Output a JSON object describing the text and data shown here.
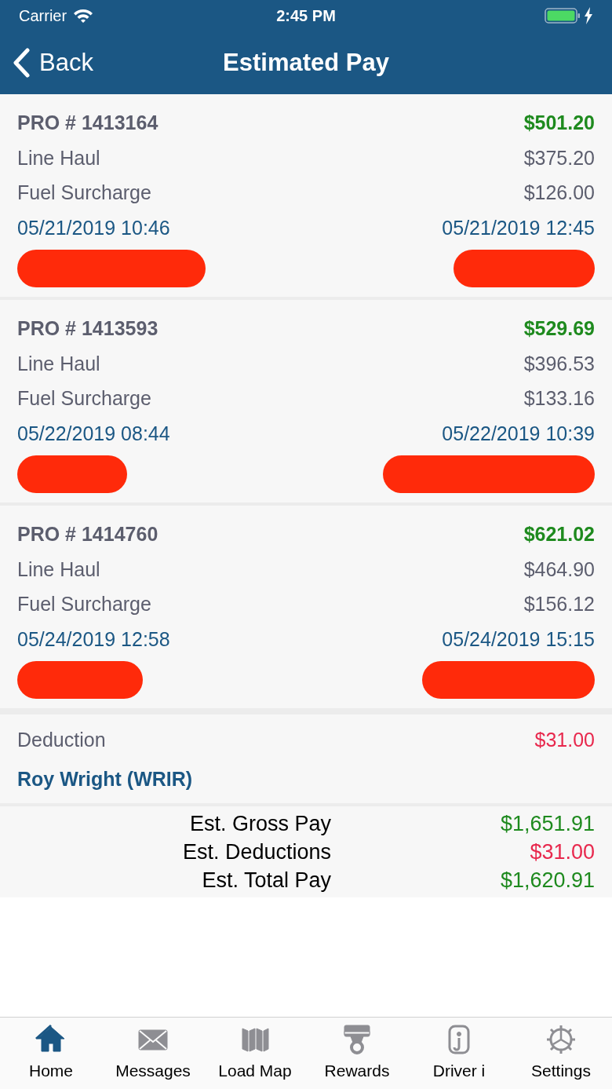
{
  "status_bar": {
    "carrier": "Carrier",
    "time": "2:45 PM",
    "charging": true
  },
  "nav": {
    "back": "Back",
    "title": "Estimated Pay"
  },
  "loads": [
    {
      "pro": "PRO # 1413164",
      "total": "$501.20",
      "lines": [
        {
          "label": "Line Haul",
          "amount": "$375.20"
        },
        {
          "label": "Fuel Surcharge",
          "amount": "$126.00"
        }
      ],
      "start": "05/21/2019 10:46",
      "end": "05/21/2019 12:45",
      "redacted": true
    },
    {
      "pro": "PRO # 1413593",
      "total": "$529.69",
      "lines": [
        {
          "label": "Line Haul",
          "amount": "$396.53"
        },
        {
          "label": "Fuel Surcharge",
          "amount": "$133.16"
        }
      ],
      "start": "05/22/2019 08:44",
      "end": "05/22/2019 10:39",
      "redacted": true
    },
    {
      "pro": "PRO # 1414760",
      "total": "$621.02",
      "lines": [
        {
          "label": "Line Haul",
          "amount": "$464.90"
        },
        {
          "label": "Fuel Surcharge",
          "amount": "$156.12"
        }
      ],
      "start": "05/24/2019 12:58",
      "end": "05/24/2019 15:15",
      "redacted": true
    }
  ],
  "deduction": {
    "label": "Deduction",
    "amount": "$31.00",
    "name": "Roy Wright (WRIR)"
  },
  "summary": [
    {
      "label": "Est. Gross Pay",
      "amount": "$1,651.91",
      "kind": "positive"
    },
    {
      "label": "Est. Deductions",
      "amount": "$31.00",
      "kind": "negative"
    },
    {
      "label": "Est. Total Pay",
      "amount": "$1,620.91",
      "kind": "positive"
    }
  ],
  "tabs": [
    {
      "label": "Home",
      "selected": true
    },
    {
      "label": "Messages",
      "selected": false
    },
    {
      "label": "Load Map",
      "selected": false
    },
    {
      "label": "Rewards",
      "selected": false
    },
    {
      "label": "Driver i",
      "selected": false
    },
    {
      "label": "Settings",
      "selected": false
    }
  ]
}
